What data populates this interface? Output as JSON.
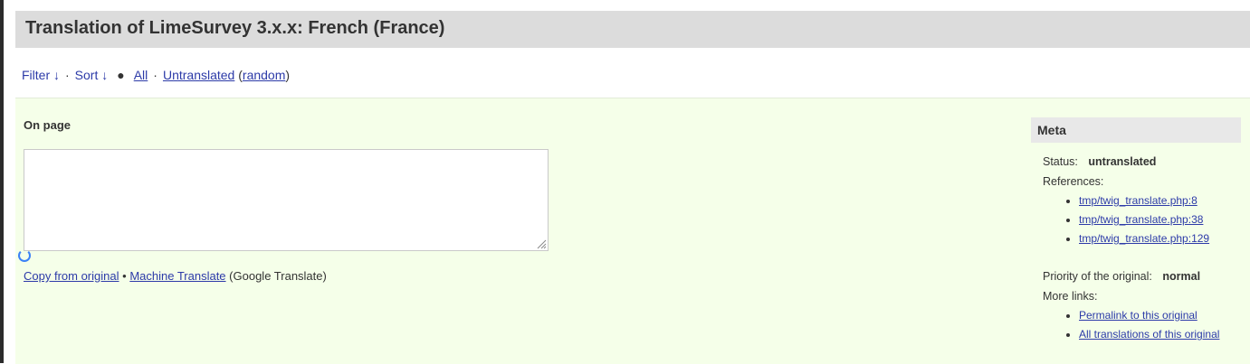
{
  "header": {
    "title": "Translation of LimeSurvey 3.x.x: French (France)"
  },
  "filterbar": {
    "filter": "Filter ↓",
    "sort": "Sort ↓",
    "all": "All",
    "untranslated": "Untranslated",
    "random": "random"
  },
  "editor": {
    "label": "On page",
    "textarea_value": "",
    "copy_from_original": "Copy from original",
    "machine_translate": "Machine Translate",
    "machine_translate_provider": "(Google Translate)"
  },
  "meta": {
    "title": "Meta",
    "status_label": "Status:",
    "status_value": "untranslated",
    "references_label": "References:",
    "references": [
      "tmp/twig_translate.php:8",
      "tmp/twig_translate.php:38",
      "tmp/twig_translate.php:129"
    ],
    "priority_label": "Priority of the original:",
    "priority_value": "normal",
    "more_links_label": "More links:",
    "more_links": [
      "Permalink to this original",
      "All translations of this original"
    ]
  },
  "colors": {
    "accent_bg": "#f5ffe9",
    "link": "#2c3aa8",
    "header_bg": "#dcdcdc"
  }
}
